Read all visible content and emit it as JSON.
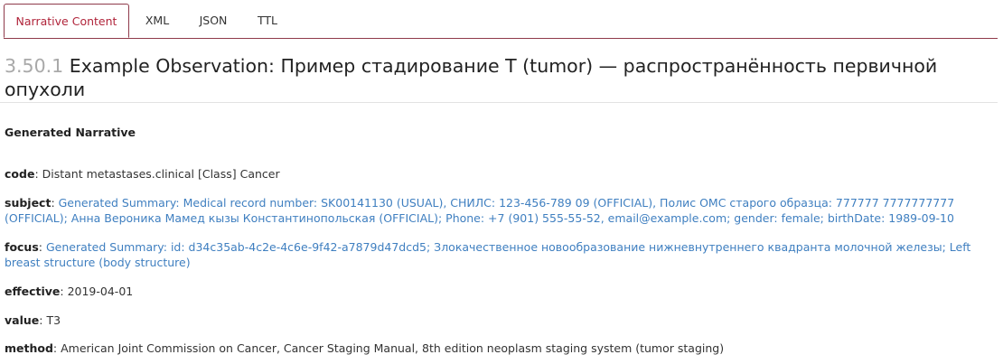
{
  "tabs": [
    "Narrative Content",
    "XML",
    "JSON",
    "TTL"
  ],
  "title": {
    "number": "3.50.1",
    "text": "Example Observation: Пример стадирование T (tumor) — распространённость первичной опухоли"
  },
  "section_heading": "Generated Narrative",
  "fields": {
    "code": {
      "label": "code",
      "value": "Distant metastases.clinical [Class] Cancer"
    },
    "subject": {
      "label": "subject",
      "value": "Generated Summary: Medical record number: SK00141130 (USUAL), СНИЛС: 123-456-789 09 (OFFICIAL), Полис ОМС старого образца: 777777 7777777777 (OFFICIAL); Анна Вероника Мамед кызы Константинопольская (OFFICIAL); Phone: +7 (901) 555-55-52, email@example.com; gender: female; birthDate: 1989-09-10"
    },
    "focus": {
      "label": "focus",
      "value": "Generated Summary: id: d34c35ab-4c2e-4c6e-9f42-a7879d47dcd5; Злокачественное новообразование нижневнутреннего квадранта молочной железы; Left breast structure (body structure)"
    },
    "effective": {
      "label": "effective",
      "value": "2019-04-01"
    },
    "value": {
      "label": "value",
      "value": "T3"
    },
    "method": {
      "label": "method",
      "value": "American Joint Commission on Cancer, Cancer Staging Manual, 8th edition neoplasm staging system (tumor staging)"
    }
  },
  "colors": {
    "accent": "#8f3a4a",
    "active_tab_text": "#b0243a",
    "link": "#3f7fc0",
    "title_number": "#a9a9a9"
  }
}
